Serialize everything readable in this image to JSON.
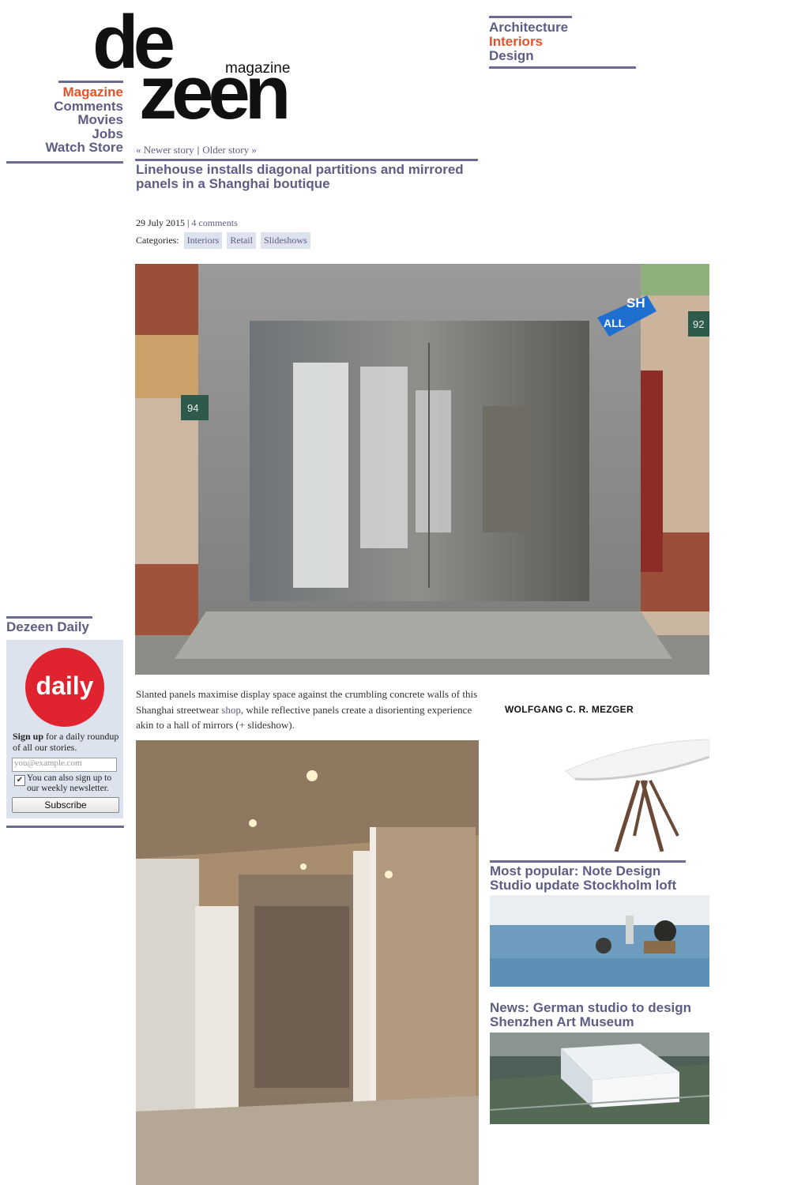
{
  "logo": {
    "top": "de",
    "bottom": "zeen",
    "tagline": "magazine"
  },
  "left_nav": [
    "Magazine",
    "Comments",
    "Movies",
    "Jobs",
    "Watch Store"
  ],
  "right_nav": [
    "Architecture",
    "Interiors",
    "Design"
  ],
  "story_nav": {
    "newer": "« Newer story",
    "older": "Older story »",
    "separator": "|"
  },
  "article": {
    "headline": "Linehouse installs diagonal partitions and mirrored panels in a Shanghai boutique",
    "date": "29 July 2015",
    "date_sep": "|",
    "comments": "4 comments",
    "categories_label": "Categories:",
    "categories": [
      "Interiors",
      "Retail",
      "Slideshows"
    ],
    "intro_before": "Slanted panels maximise display space against the crumbling concrete walls of this Shanghai streetwear ",
    "intro_link": "shop",
    "intro_after": ", while reflective panels create a disorienting experience akin to a hall of mirrors (+ slideshow).",
    "hero_sign_left": "ALL",
    "hero_sign_right": "SH",
    "hero_plate_left": "94",
    "hero_plate_right": "92"
  },
  "daily": {
    "title": "Dezeen Daily",
    "logo_text": "daily",
    "signup_bold": "Sign up",
    "signup_rest": " for a daily roundup of all our stories.",
    "email_placeholder": "you@example.com",
    "checkbox_label": "You can also sign up to our weekly newsletter.",
    "subscribe": "Subscribe"
  },
  "ad": {
    "brand": "WOLFGANG C. R. MEZGER"
  },
  "popular": {
    "title": "Most popular: Note Design Studio update Stockholm loft"
  },
  "news": {
    "title": "News: German studio to design Shenzhen Art Museum"
  },
  "colors": {
    "accent": "#e1542b",
    "nav": "#5d5d85",
    "rule": "#6b6b8f",
    "daily_red": "#e0242f",
    "panel": "#dde3ee"
  }
}
